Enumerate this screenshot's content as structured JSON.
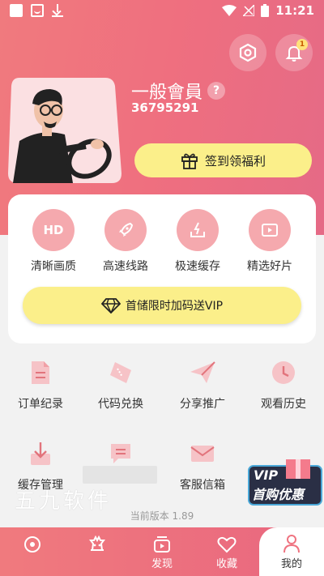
{
  "status_bar": {
    "time": "11:21"
  },
  "header": {
    "notification_count": "1"
  },
  "profile": {
    "level": "一般會員",
    "help": "?",
    "user_id": "36795291",
    "signin_label": "签到领福利"
  },
  "features": [
    {
      "label": "清晰画质",
      "icon": "hd-icon",
      "icon_text": "HD"
    },
    {
      "label": "高速线路",
      "icon": "rocket-icon"
    },
    {
      "label": "极速缓存",
      "icon": "download-icon"
    },
    {
      "label": "精选好片",
      "icon": "play-icon"
    }
  ],
  "vip_promo": {
    "label": "首储限时加码送VIP"
  },
  "menu": [
    {
      "label": "订单纪录",
      "icon": "document-icon"
    },
    {
      "label": "代码兑换",
      "icon": "ticket-icon"
    },
    {
      "label": "分享推广",
      "icon": "paper-plane-icon"
    },
    {
      "label": "观看历史",
      "icon": "clock-icon"
    },
    {
      "label": "缓存管理",
      "icon": "download-icon"
    },
    {
      "label": "",
      "icon": "message-icon"
    },
    {
      "label": "客服信箱",
      "icon": "mail-icon"
    }
  ],
  "floating_promo": {
    "line1": "VIP",
    "line2": "首购优惠"
  },
  "watermark": "五九软件",
  "version": "当前版本 1.89",
  "tabs": [
    {
      "label": "",
      "icon": "target-icon"
    },
    {
      "label": "",
      "icon": "chess-icon"
    },
    {
      "label": "发现",
      "icon": "video-icon"
    },
    {
      "label": "收藏",
      "icon": "heart-icon"
    },
    {
      "label": "我的",
      "icon": "person-icon"
    }
  ],
  "colors": {
    "accent": "#ef7380",
    "button_yellow": "#fbef8a",
    "icon_pink": "#f5a9ae"
  }
}
